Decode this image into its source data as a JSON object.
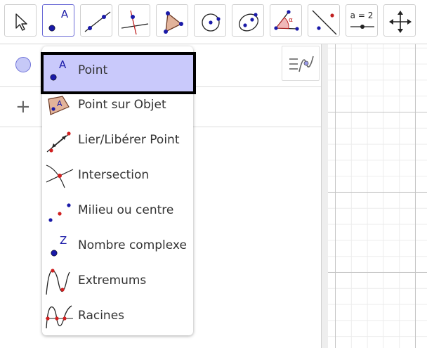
{
  "toolbar": {
    "tools": [
      {
        "name": "move-tool",
        "text": ""
      },
      {
        "name": "point-tool",
        "text": "A"
      },
      {
        "name": "line-tool",
        "text": ""
      },
      {
        "name": "perpendicular-line-tool",
        "text": ""
      },
      {
        "name": "polygon-tool",
        "text": ""
      },
      {
        "name": "circle-center-point-tool",
        "text": ""
      },
      {
        "name": "ellipse-tool",
        "text": ""
      },
      {
        "name": "angle-tool",
        "text": "α"
      },
      {
        "name": "reflect-tool",
        "text": ""
      },
      {
        "name": "slider-tool",
        "text": "a = 2"
      },
      {
        "name": "move-graphics-view-tool",
        "text": ""
      }
    ],
    "active_index": 1
  },
  "algebra": {
    "add_symbol": "+"
  },
  "menu": {
    "items": [
      {
        "label": "Point",
        "icon": "point-icon",
        "selected": true
      },
      {
        "label": "Point sur Objet",
        "icon": "point-on-object-icon"
      },
      {
        "label": "Lier/Libérer Point",
        "icon": "attach-detach-point-icon"
      },
      {
        "label": "Intersection",
        "icon": "intersection-icon"
      },
      {
        "label": "Milieu ou centre",
        "icon": "midpoint-icon"
      },
      {
        "label": "Nombre complexe",
        "icon": "complex-number-icon"
      },
      {
        "label": "Extremums",
        "icon": "extremum-icon"
      },
      {
        "label": "Racines",
        "icon": "roots-icon"
      }
    ],
    "icon_letters": {
      "point": "A",
      "point_on_object": "A",
      "complex": "Z"
    }
  },
  "colors": {
    "accent": "#6b6bd6",
    "selected_bg": "#c9c9fb",
    "point_blue": "#1a1aa8",
    "red_point": "#d02020"
  }
}
